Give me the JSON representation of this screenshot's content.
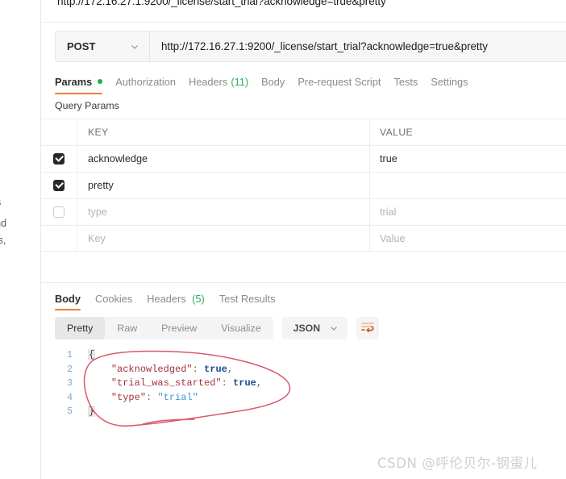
{
  "sidebar": {
    "clipped_title": "ests",
    "clipped_line1": "ts and",
    "clipped_line2": "cripts,"
  },
  "top_url_line": "http://172.16.27.1:9200/_license/start_trial?acknowledge=true&pretty",
  "request": {
    "method": "POST",
    "method_caret_icon": "chevron-down-icon",
    "url": "http://172.16.27.1:9200/_license/start_trial?acknowledge=true&pretty",
    "tabs": [
      {
        "label": "Params",
        "active": true,
        "dot": true
      },
      {
        "label": "Authorization",
        "active": false
      },
      {
        "label": "Headers",
        "active": false,
        "count": "(11)"
      },
      {
        "label": "Body",
        "active": false
      },
      {
        "label": "Pre-request Script",
        "active": false
      },
      {
        "label": "Tests",
        "active": false
      },
      {
        "label": "Settings",
        "active": false
      }
    ],
    "query_params_label": "Query Params",
    "table": {
      "headers": {
        "key": "KEY",
        "value": "VALUE"
      },
      "rows": [
        {
          "checked": true,
          "checkbox_visible": true,
          "key": "acknowledge",
          "value": "true",
          "ghost": false
        },
        {
          "checked": true,
          "checkbox_visible": true,
          "key": "pretty",
          "value": "",
          "ghost": false
        },
        {
          "checked": false,
          "checkbox_visible": true,
          "key": "type",
          "value": "trial",
          "ghost": true
        },
        {
          "checked": false,
          "checkbox_visible": false,
          "key": "Key",
          "value": "Value",
          "ghost": true
        }
      ]
    }
  },
  "response": {
    "tabs": [
      {
        "label": "Body",
        "active": true
      },
      {
        "label": "Cookies",
        "active": false
      },
      {
        "label": "Headers",
        "active": false,
        "count": "(5)"
      },
      {
        "label": "Test Results",
        "active": false
      }
    ],
    "format_tabs": [
      {
        "label": "Pretty",
        "active": true
      },
      {
        "label": "Raw",
        "active": false
      },
      {
        "label": "Preview",
        "active": false
      },
      {
        "label": "Visualize",
        "active": false
      }
    ],
    "language": "JSON",
    "language_caret_icon": "chevron-down-icon",
    "wrap_button_icon": "word-wrap-icon",
    "body_lines": [
      {
        "num": "1",
        "segments": [
          {
            "t": "{",
            "c": "brace"
          }
        ]
      },
      {
        "num": "2",
        "segments": [
          {
            "t": "    ",
            "c": "ctext"
          },
          {
            "t": "\"acknowledged\"",
            "c": "k"
          },
          {
            "t": ": ",
            "c": "punc"
          },
          {
            "t": "true",
            "c": "bool"
          },
          {
            "t": ",",
            "c": "punc"
          }
        ]
      },
      {
        "num": "3",
        "segments": [
          {
            "t": "    ",
            "c": "ctext"
          },
          {
            "t": "\"trial_was_started\"",
            "c": "k"
          },
          {
            "t": ": ",
            "c": "punc"
          },
          {
            "t": "true",
            "c": "bool"
          },
          {
            "t": ",",
            "c": "punc"
          }
        ]
      },
      {
        "num": "4",
        "segments": [
          {
            "t": "    ",
            "c": "ctext"
          },
          {
            "t": "\"type\"",
            "c": "k"
          },
          {
            "t": ": ",
            "c": "punc"
          },
          {
            "t": "\"trial\"",
            "c": "str"
          }
        ]
      },
      {
        "num": "5",
        "segments": [
          {
            "t": "}",
            "c": "brace"
          }
        ]
      }
    ]
  },
  "annotation": {
    "shape": "hand-drawn-red-ellipse",
    "color": "#d9576a"
  },
  "watermark": "CSDN @呼伦贝尔-钢蛋儿",
  "colors": {
    "accent_orange": "#ef7d3a",
    "green_dot": "#1fab54",
    "green_count": "#2eaa59",
    "annotation_red": "#d9576a"
  }
}
